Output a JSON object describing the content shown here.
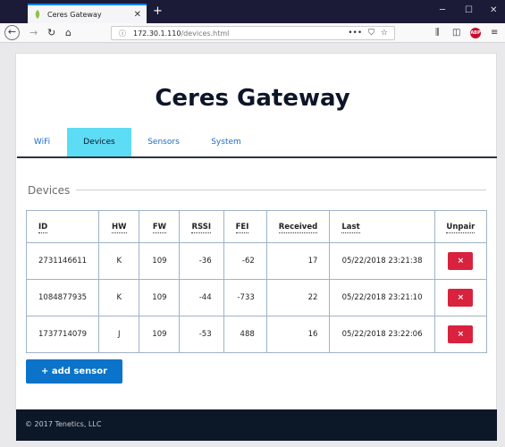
{
  "browser": {
    "tab_title": "Ceres Gateway",
    "tab_close": "✕",
    "new_tab": "+",
    "url_host": "172.30.1.110",
    "url_path": "/devices.html",
    "more": "•••"
  },
  "page": {
    "title": "Ceres Gateway",
    "tabs": [
      {
        "label": "WiFi"
      },
      {
        "label": "Devices"
      },
      {
        "label": "Sensors"
      },
      {
        "label": "System"
      }
    ],
    "section_title": "Devices",
    "table": {
      "headers": [
        "ID",
        "HW",
        "FW",
        "RSSI",
        "FEI",
        "Received",
        "Last",
        "Unpair"
      ],
      "rows": [
        {
          "id": "2731146611",
          "hw": "K",
          "fw": "109",
          "rssi": "-36",
          "fei": "-62",
          "received": "17",
          "last": "05/22/2018 23:21:38",
          "unpair": "×"
        },
        {
          "id": "1084877935",
          "hw": "K",
          "fw": "109",
          "rssi": "-44",
          "fei": "-733",
          "received": "22",
          "last": "05/22/2018 23:21:10",
          "unpair": "×"
        },
        {
          "id": "1737714079",
          "hw": "J",
          "fw": "109",
          "rssi": "-53",
          "fei": "488",
          "received": "16",
          "last": "05/22/2018 23:22:06",
          "unpair": "×"
        }
      ]
    },
    "add_button": "+ add sensor",
    "footer": "© 2017 Tenetics, LLC"
  },
  "colors": {
    "active_tab": "#5ddcf5",
    "primary_button": "#0b73c9",
    "danger_button": "#d8223e",
    "footer_bg": "#0c1727"
  }
}
